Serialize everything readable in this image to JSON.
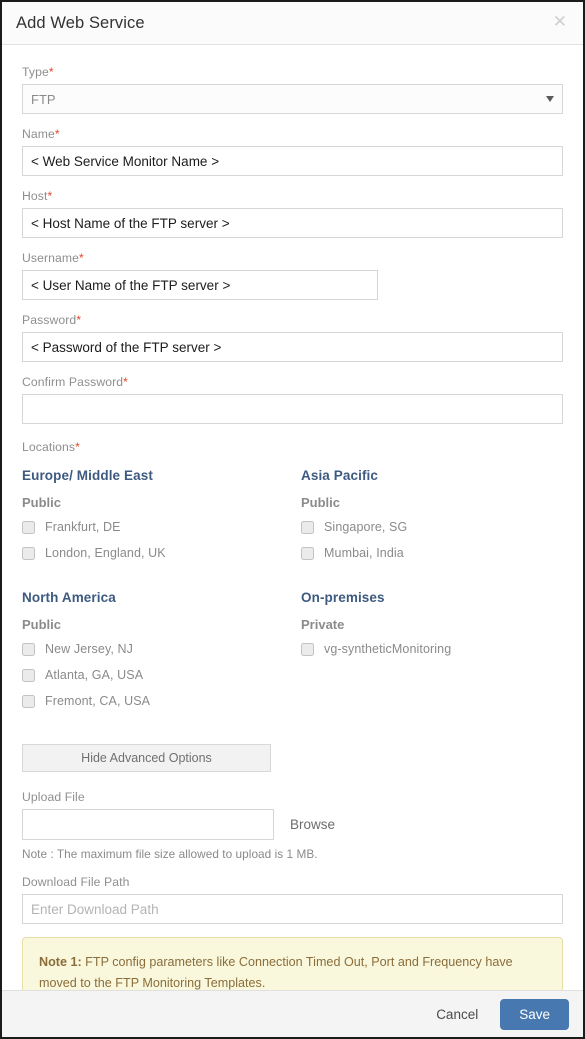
{
  "dialog": {
    "title": "Add Web Service",
    "close_icon": "close-icon"
  },
  "form": {
    "type": {
      "label": "Type",
      "required": "*",
      "value": "FTP",
      "options": [
        "FTP"
      ]
    },
    "name": {
      "label": "Name",
      "required": "*",
      "value": "< Web Service Monitor Name >"
    },
    "host": {
      "label": "Host",
      "required": "*",
      "value": "< Host Name of the FTP server >"
    },
    "username": {
      "label": "Username",
      "required": "*",
      "value": "< User Name of the FTP server >"
    },
    "password": {
      "label": "Password",
      "required": "*",
      "value": "< Password of the FTP server >"
    },
    "confirm_password": {
      "label": "Confirm Password",
      "required": "*",
      "value": ""
    }
  },
  "locations": {
    "label": "Locations",
    "required": "*",
    "groups": [
      {
        "region": "Europe/ Middle East",
        "access": "Public",
        "items": [
          {
            "label": "Frankfurt, DE",
            "checked": false
          },
          {
            "label": "London, England, UK",
            "checked": false
          }
        ]
      },
      {
        "region": "Asia Pacific",
        "access": "Public",
        "items": [
          {
            "label": "Singapore, SG",
            "checked": false
          },
          {
            "label": "Mumbai, India",
            "checked": false
          }
        ]
      },
      {
        "region": "North America",
        "access": "Public",
        "items": [
          {
            "label": "New Jersey, NJ",
            "checked": false
          },
          {
            "label": "Atlanta, GA, USA",
            "checked": false
          },
          {
            "label": "Fremont, CA, USA",
            "checked": false
          }
        ]
      },
      {
        "region": "On-premises",
        "access": "Private",
        "items": [
          {
            "label": "vg-syntheticMonitoring",
            "checked": false
          }
        ]
      }
    ]
  },
  "advanced": {
    "toggle_label": "Hide Advanced Options",
    "upload": {
      "label": "Upload File",
      "value": "",
      "browse_label": "Browse",
      "note": "Note : The maximum file size allowed to upload is 1 MB."
    },
    "download": {
      "label": "Download File Path",
      "value": "",
      "placeholder": "Enter Download Path"
    },
    "note_box": {
      "prefix": "Note 1:",
      "text": " FTP config parameters like Connection Timed Out, Port and Frequency have moved to the FTP Monitoring Templates."
    }
  },
  "footer": {
    "cancel_label": "Cancel",
    "save_label": "Save"
  },
  "colors": {
    "accent": "#4878b0",
    "region_heading": "#3d5a80",
    "required_asterisk": "#e8442a",
    "note_bg": "#faf8dc",
    "note_text": "#8a6d3b"
  }
}
